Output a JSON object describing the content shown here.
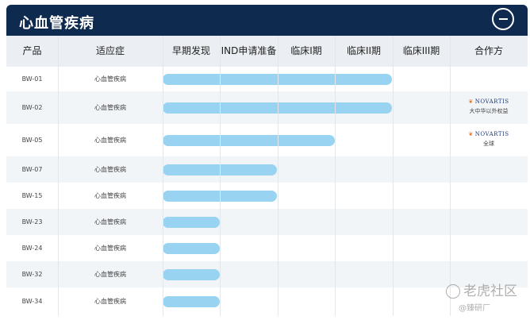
{
  "header": {
    "title": "心血管疾病",
    "collapse_icon": "minus-circle-icon"
  },
  "columns": [
    "产品",
    "适应症",
    "早期发现",
    "IND申请准备",
    "临床I期",
    "临床II期",
    "临床III期",
    "合作方"
  ],
  "stages": [
    "早期发现",
    "IND申请准备",
    "临床I期",
    "临床II期"
  ],
  "rows": [
    {
      "product": "BW-01",
      "indication": "心血管疾病",
      "progress_stages": 4.0,
      "partner": null
    },
    {
      "product": "BW-02",
      "indication": "心血管疾病",
      "progress_stages": 4.0,
      "partner": {
        "logo": "NOVARTIS",
        "note": "大中华以外权益"
      }
    },
    {
      "product": "BW-05",
      "indication": "心血管疾病",
      "progress_stages": 3.0,
      "partner": {
        "logo": "NOVARTIS",
        "note": "全球"
      }
    },
    {
      "product": "BW-07",
      "indication": "心血管疾病",
      "progress_stages": 2.0,
      "partner": null
    },
    {
      "product": "BW-15",
      "indication": "心血管疾病",
      "progress_stages": 2.0,
      "partner": null
    },
    {
      "product": "BW-23",
      "indication": "心血管疾病",
      "progress_stages": 1.0,
      "partner": null
    },
    {
      "product": "BW-24",
      "indication": "心血管疾病",
      "progress_stages": 1.0,
      "partner": null
    },
    {
      "product": "BW-32",
      "indication": "心血管疾病",
      "progress_stages": 1.0,
      "partner": null
    },
    {
      "product": "BW-34",
      "indication": "心血管疾病",
      "progress_stages": 1.0,
      "partner": null
    }
  ],
  "colors": {
    "header_bg": "#0e2a4f",
    "bar": "#98d4f2",
    "table_header_bg": "#ebeef2",
    "row_alt_bg": "#f2f5f8",
    "novartis_flame": "#e0782b",
    "novartis_text": "#1b3a7a"
  },
  "watermark": {
    "main": "老虎社区",
    "sub": "@臻研厂"
  }
}
